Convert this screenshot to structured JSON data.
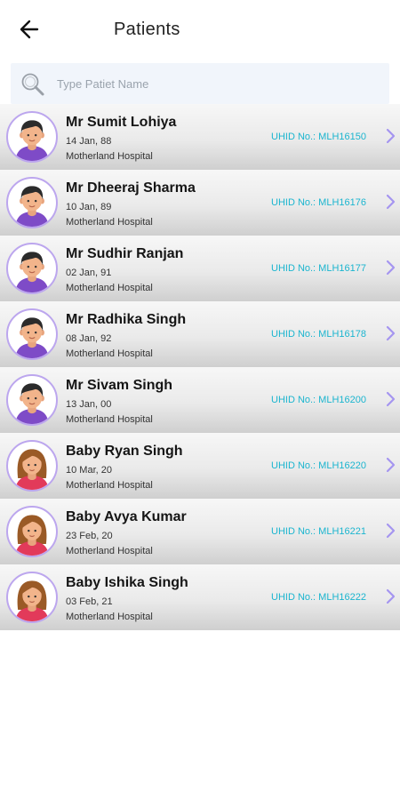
{
  "header": {
    "title": "Patients",
    "back_icon": "arrow-left-icon"
  },
  "search": {
    "placeholder": "Type Patiet Name",
    "value": "",
    "icon": "search-icon"
  },
  "colors": {
    "accent": "#1bb5cf",
    "avatar_border": "#bca6ee",
    "chevron": "#a595f0"
  },
  "patients": [
    {
      "name": "Mr Sumit Lohiya",
      "dob": "14 Jan, 88",
      "hospital": "Motherland Hospital",
      "uhid": "UHID No.: MLH16150",
      "avatar": "male-avatar-icon"
    },
    {
      "name": "Mr Dheeraj Sharma",
      "dob": "10 Jan, 89",
      "hospital": "Motherland Hospital",
      "uhid": "UHID No.: MLH16176",
      "avatar": "male-avatar-icon"
    },
    {
      "name": "Mr Sudhir Ranjan",
      "dob": "02 Jan, 91",
      "hospital": "Motherland Hospital",
      "uhid": "UHID No.: MLH16177",
      "avatar": "male-avatar-icon"
    },
    {
      "name": "Mr Radhika Singh",
      "dob": "08 Jan, 92",
      "hospital": "Motherland Hospital",
      "uhid": "UHID No.: MLH16178",
      "avatar": "male-avatar-icon"
    },
    {
      "name": "Mr Sivam Singh",
      "dob": "13 Jan, 00",
      "hospital": "Motherland Hospital",
      "uhid": "UHID No.: MLH16200",
      "avatar": "male-avatar-icon"
    },
    {
      "name": "Baby Ryan Singh",
      "dob": "10 Mar, 20",
      "hospital": "Motherland Hospital",
      "uhid": "UHID No.: MLH16220",
      "avatar": "female-avatar-icon"
    },
    {
      "name": "Baby Avya Kumar",
      "dob": "23 Feb, 20",
      "hospital": "Motherland Hospital",
      "uhid": "UHID No.: MLH16221",
      "avatar": "female-avatar-icon"
    },
    {
      "name": "Baby Ishika Singh",
      "dob": "03 Feb, 21",
      "hospital": "Motherland Hospital",
      "uhid": "UHID No.: MLH16222",
      "avatar": "female-avatar-icon"
    }
  ]
}
